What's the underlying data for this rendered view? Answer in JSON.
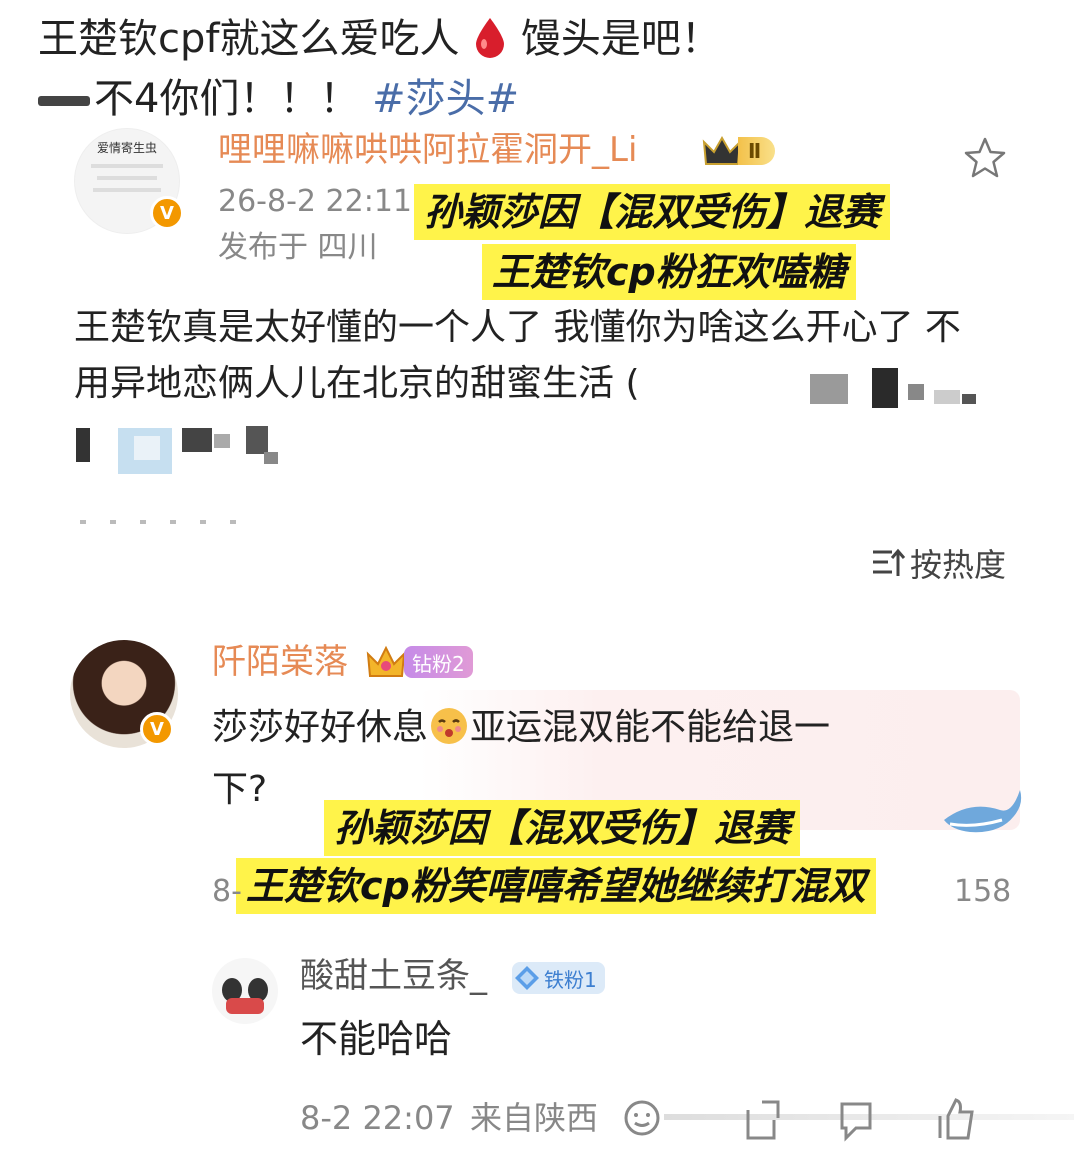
{
  "post": {
    "line1": "王楚钦cpf就这么爱吃人",
    "line1_tail": "馒头是吧！",
    "line2": "不4你们！！！",
    "hashtag": "#莎头#"
  },
  "comment1": {
    "username": "哩哩嘛嘛哄哄阿拉霍洞开_Li",
    "level_badge": "Ⅱ",
    "time": "26-8-2 22:11",
    "location": "发布于 四川",
    "text": "王楚钦真是太好懂的一个人了 我懂你为啥这么开心了 不用异地恋俩人儿在北京的甜蜜生活 (",
    "avatar_text": "爱情寄生虫"
  },
  "caption1": {
    "line1": "孙颖莎因【混双受伤】退赛",
    "line2": "王楚钦cp粉狂欢嗑糖"
  },
  "sort": {
    "label": "按热度"
  },
  "comment2": {
    "username": "阡陌棠落",
    "fan_badge": "钻粉2",
    "text_part1": "莎莎好好休息",
    "text_part2": "亚运混双能不能给退一",
    "text_part3": "下?",
    "time_partial": "8-",
    "likes": "158"
  },
  "caption2": {
    "line1": "孙颖莎因【混双受伤】退赛",
    "line2": "王楚钦cp粉笑嘻嘻希望她继续打混双"
  },
  "reply": {
    "username": "酸甜土豆条_",
    "fan_badge": "铁粉1",
    "text": "不能哈哈",
    "time": "8-2 22:07",
    "location": "来自陕西"
  },
  "colors": {
    "username": "#e68a55",
    "hashtag": "#4a6da8",
    "caption_bg": "#fff34a",
    "verified": "#f39800"
  }
}
